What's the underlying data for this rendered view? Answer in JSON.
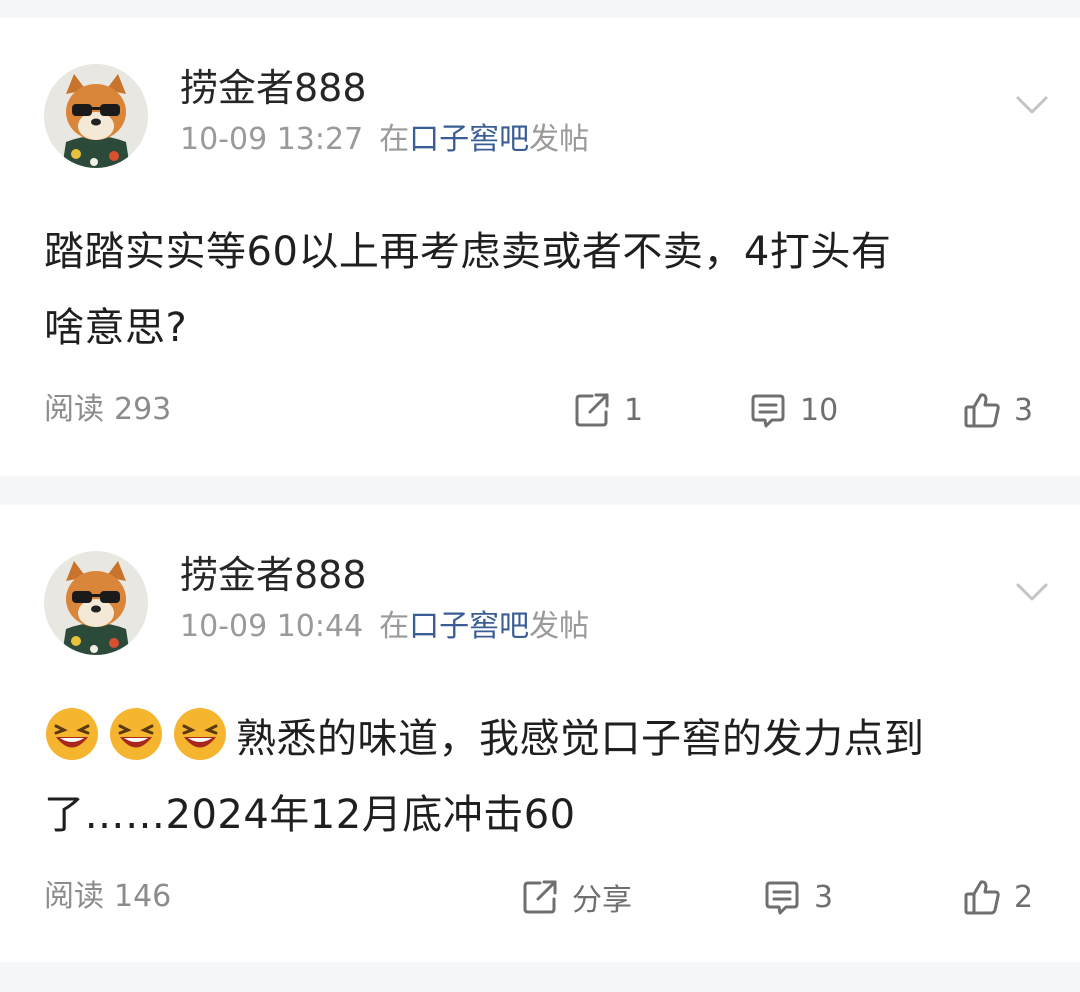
{
  "posts": [
    {
      "username": "捞金者888",
      "time": "10-09 13:27",
      "forum_prefix": "在",
      "forum_name": "口子窖吧",
      "forum_suffix": "发帖",
      "content_line1": "踏踏实实等60以上再考虑卖或者不卖，4打头有",
      "content_line2": "啥意思?",
      "read_label": "阅读",
      "read_count": "293",
      "share_label": "1",
      "comment_count": "10",
      "like_count": "3",
      "avatar_icon": "shiba-dog-sunglasses-avatar",
      "menu_icon": "chevron-down-icon"
    },
    {
      "username": "捞金者888",
      "time": "10-09 10:44",
      "forum_prefix": "在",
      "forum_name": "口子窖吧",
      "forum_suffix": "发帖",
      "content_text1": "熟悉的味道，我感觉口子窖的发力点到",
      "content_line2": "了……2024年12月底冲击60",
      "emoji_icon": "laughing-emoji",
      "read_label": "阅读",
      "read_count": "146",
      "share_label": "分享",
      "comment_count": "3",
      "like_count": "2",
      "avatar_icon": "shiba-dog-sunglasses-avatar",
      "menu_icon": "chevron-down-icon"
    }
  ],
  "colors": {
    "forum_link": "#3a5e94",
    "meta_gray": "#9a9a9a",
    "page_bg": "#f6f7f9"
  }
}
